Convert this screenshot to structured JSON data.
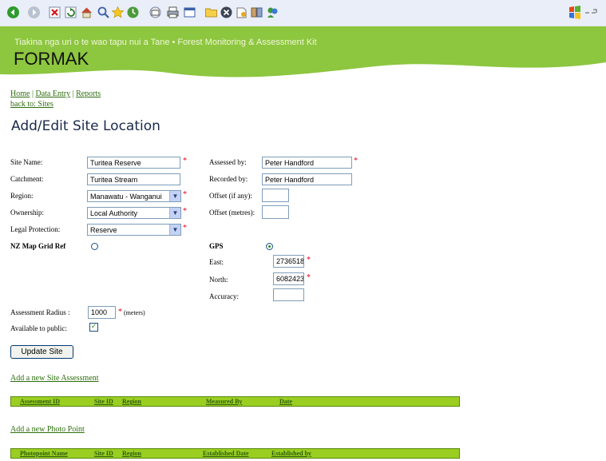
{
  "toolbar": {
    "icons": [
      "back-icon",
      "forward-icon",
      "stop-icon",
      "refresh-icon",
      "home-icon",
      "search-icon",
      "favorites-icon",
      "history-icon",
      "mail-icon",
      "print-icon",
      "edit-icon",
      "folder-icon",
      "messenger-icon",
      "discuss-icon",
      "research-icon",
      "msn-icon"
    ]
  },
  "banner": {
    "tagline": "Tiakina nga uri o te wao tapu nui a Tane • Forest Monitoring & Assessment Kit",
    "brand": "FORMAK",
    "color": "#8dc63f"
  },
  "nav": {
    "home": "Home",
    "data_entry": "Data Entry",
    "reports": "Reports",
    "separator": "|",
    "back": "back to: Sites"
  },
  "page_title": "Add/Edit Site Location",
  "form": {
    "site_name_label": "Site Name:",
    "site_name_value": "Turitea Reserve",
    "catchment_label": "Catchment:",
    "catchment_value": "Turitea Stream",
    "region_label": "Region:",
    "region_value": "Manawatu - Wanganui",
    "ownership_label": "Ownership:",
    "ownership_value": "Local Authority",
    "legal_label": "Legal Protection:",
    "legal_value": "Reserve",
    "nzmap_label": "NZ Map Grid Ref",
    "assessed_label": "Assessed by:",
    "assessed_value": "Peter Handford",
    "recorded_label": "Recorded by:",
    "recorded_value": "Peter Handford",
    "offset_any_label": "Offset (if any):",
    "offset_any_value": "",
    "offset_m_label": "Offset (metres):",
    "offset_m_value": "",
    "gps_label": "GPS",
    "east_label": "East:",
    "east_value": "2736518",
    "north_label": "North:",
    "north_value": "6082423",
    "accuracy_label": "Accuracy:",
    "accuracy_value": "",
    "radius_label": "Assessment Radius :",
    "radius_value": "1000",
    "radius_unit": "(meters)",
    "public_label": "Available to public:",
    "required_mark": "*",
    "update_button": "Update Site"
  },
  "assessments": {
    "add_link": "Add a new Site Assessment",
    "columns": [
      "Assessment ID",
      "Site ID",
      "Region",
      "Measured By",
      "Date"
    ]
  },
  "photos": {
    "add_link": "Add a new Photo Point",
    "columns": [
      "Photopoint Name",
      "Site ID",
      "Region",
      "Established Date",
      "Established by"
    ]
  },
  "colors": {
    "grid_header": "#9ace21",
    "required": "#e8001a",
    "link": "#2e6e0e"
  }
}
